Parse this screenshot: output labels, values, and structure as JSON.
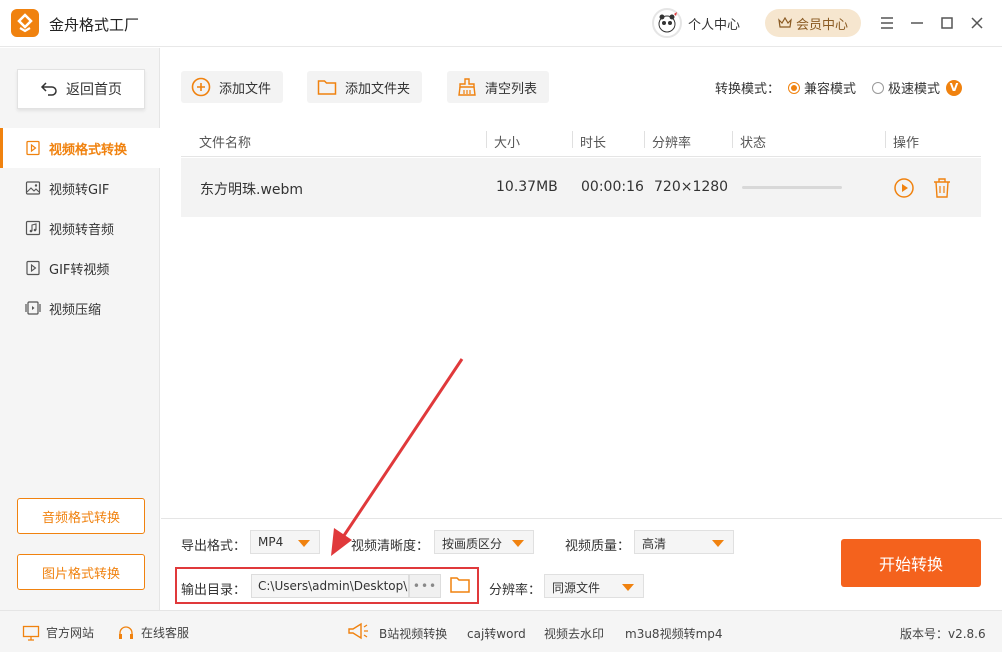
{
  "app": {
    "title": "金舟格式工厂"
  },
  "header": {
    "user_center": "个人中心",
    "vip_center": "会员中心"
  },
  "sidebar": {
    "back_label": "返回首页",
    "items": [
      {
        "label": "视频格式转换",
        "active": true
      },
      {
        "label": "视频转GIF"
      },
      {
        "label": "视频转音频"
      },
      {
        "label": "GIF转视频"
      },
      {
        "label": "视频压缩"
      }
    ],
    "audio_btn": "音频格式转换",
    "image_btn": "图片格式转换"
  },
  "toolbar": {
    "add_file": "添加文件",
    "add_folder": "添加文件夹",
    "clear_list": "清空列表",
    "mode_label": "转换模式：",
    "mode_compat": "兼容模式",
    "mode_fast": "极速模式",
    "mode_badge": "V"
  },
  "table": {
    "headers": {
      "name": "文件名称",
      "size": "大小",
      "duration": "时长",
      "resolution": "分辨率",
      "status": "状态",
      "action": "操作"
    },
    "rows": [
      {
        "name": "东方明珠.webm",
        "size": "10.37MB",
        "duration": "00:00:16",
        "resolution": "720×1280",
        "progress": 0
      }
    ]
  },
  "settings": {
    "export_format_label": "导出格式：",
    "export_format_value": "MP4",
    "clarity_label": "视频清晰度：",
    "clarity_value": "按画质区分",
    "quality_label": "视频质量：",
    "quality_value": "高清",
    "output_dir_label": "输出目录：",
    "output_dir_value": "C:\\Users\\admin\\Desktop\\",
    "dots": "•••",
    "resolution_label": "分辨率：",
    "resolution_value": "同源文件",
    "start_btn": "开始转换"
  },
  "statusbar": {
    "website": "官方网站",
    "service": "在线客服",
    "links": [
      "B站视频转换",
      "caj转word",
      "视频去水印",
      "m3u8视频转mp4"
    ],
    "version": "版本号：v2.8.6"
  },
  "colors": {
    "accent": "#f0820f",
    "start_button": "#f4621d",
    "annotation": "#e0393b"
  }
}
